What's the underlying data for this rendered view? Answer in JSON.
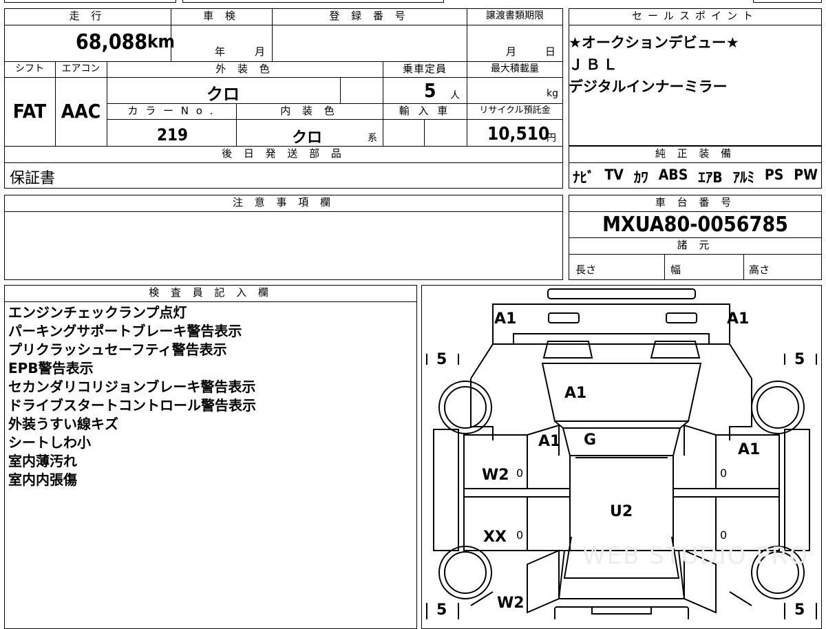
{
  "top": {
    "h_mileage": "走 行",
    "h_inspection": "車 検",
    "h_reg": "登 録 番 号",
    "h_deadline": "譲渡書類期限",
    "mileage": "68,088",
    "mileage_unit": "km",
    "insp_year": "年",
    "insp_month": "月",
    "dl_month": "月",
    "dl_day": "日",
    "h_shift": "シフト",
    "h_ac": "エアコン",
    "h_ext_color": "外 装 色",
    "h_capacity": "乗車定員",
    "h_max_load": "最大積載量",
    "shift": "FAT",
    "ac": "AAC",
    "ext_color": "クロ",
    "capacity": "5",
    "capacity_unit": "人",
    "max_load_unit": "kg",
    "h_color_no": "カ ラ ー N o .",
    "h_int_color": "内 装 色",
    "h_import": "輸 入 車",
    "h_recycle": "リサイクル預託金",
    "color_no": "219",
    "int_color": "クロ",
    "int_color_suffix": "系",
    "recycle": "10,510",
    "recycle_unit": "円",
    "h_later": "後 日 発 送 部 品",
    "later_parts": "保証書"
  },
  "sales": {
    "header": "セールスポイント",
    "lines": [
      "★オークションデビュー★",
      "ＪＢＬ",
      "デジタルインナーミラー"
    ]
  },
  "equip": {
    "header": "純 正 装 備",
    "items": [
      "ﾅﾋﾞ",
      "TV",
      "ｶﾜ",
      "ABS",
      "ｴｱB",
      "ｱﾙﾐ",
      "PS",
      "PW"
    ]
  },
  "notes": {
    "header": "注 意 事 項 欄"
  },
  "chassis": {
    "header": "車 台 番 号",
    "number": "MXUA80-0056785",
    "specs_header": "諸 元",
    "length": "長さ",
    "width": "幅",
    "height": "高さ"
  },
  "inspector": {
    "header": "検 査 員 記 入 欄",
    "lines": [
      "エンジンチェックランプ点灯",
      "パーキングサポートブレーキ警告表示",
      "プリクラッシュセーフティ警告表示",
      "EPB警告表示",
      "セカンダリコリジョンブレーキ警告表示",
      "ドライブスタートコントロール警告表示",
      "外装うすい線キズ",
      "シートしわ小",
      "室内薄汚れ",
      "室内内張傷"
    ]
  },
  "diagram": {
    "front_left": "A1",
    "front_right": "A1",
    "hood": "A1",
    "pillar": "A1",
    "windshield": "G",
    "right_front_door": "A1",
    "roof": "U2",
    "left_front_door": "W2",
    "left_rear_door": "XX",
    "left_quarter": "W2",
    "tire_depth": "5",
    "tread_mark": "0",
    "watermark": "WEB STUDIO PRO"
  }
}
